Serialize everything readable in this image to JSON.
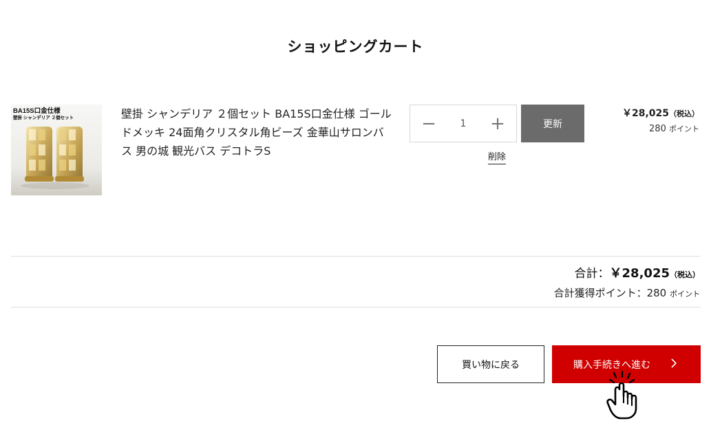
{
  "page": {
    "title": "ショッピングカート"
  },
  "item": {
    "thumbnail": {
      "icon": "chandelier-product-image",
      "caption1": "BA15S口金仕様",
      "caption2": "壁掛 シャンデリア ２個セット"
    },
    "name": "壁掛 シャンデリア ２個セット BA15S口金仕様 ゴールドメッキ 24面角クリスタル角ビーズ 金華山サロンバス 男の城 観光バス デコトラS",
    "quantity": "1",
    "minus_symbol": "−",
    "plus_symbol": "+",
    "update_label": "更新",
    "delete_label": "削除",
    "price": "￥28,025",
    "price_tax": "（税込）",
    "points": "280",
    "points_unit": "ポイント"
  },
  "summary": {
    "total_label": "合計：",
    "total_value": "￥28,025",
    "total_tax": "（税込）",
    "points_label": "合計獲得ポイント：",
    "points_value": "280",
    "points_unit": "ポイント"
  },
  "actions": {
    "back_label": "買い物に戻る",
    "checkout_label": "購入手続きへ進む",
    "checkout_icon": "chevron-right-icon"
  },
  "cursor": {
    "icon": "hand-pointer-click-icon"
  },
  "colors": {
    "accent_red": "#d00000",
    "update_gray": "#6b6b6b",
    "divider": "#dedede"
  }
}
